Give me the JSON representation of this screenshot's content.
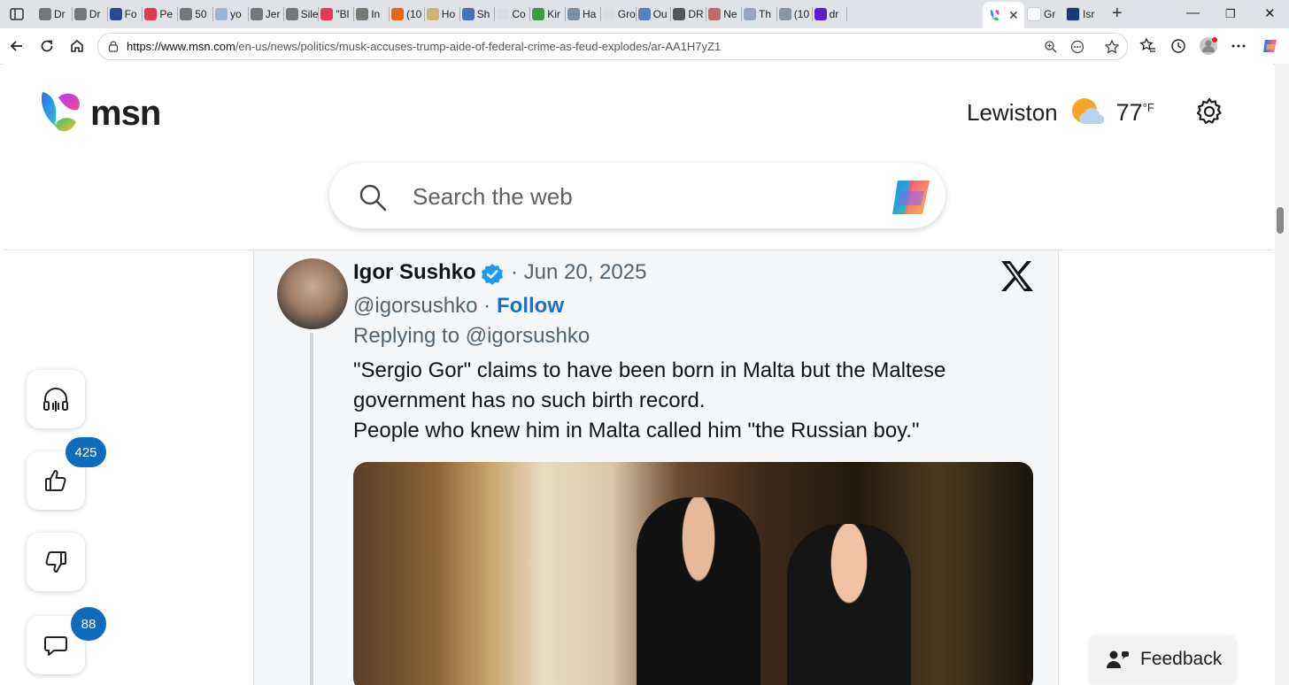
{
  "browser": {
    "tabs": [
      {
        "label": "Dr",
        "icon": "globe-icon",
        "color": "#777777"
      },
      {
        "label": "Dr",
        "icon": "globe-icon",
        "color": "#777777"
      },
      {
        "label": "Fo",
        "icon": "news-icon",
        "color": "#2b4a8b"
      },
      {
        "label": "Pe",
        "icon": "youtube-icon",
        "color": "#e03b54"
      },
      {
        "label": "50",
        "icon": "globe-icon",
        "color": "#777777"
      },
      {
        "label": "yo",
        "icon": "bing-icon",
        "color": "#9fb5d6"
      },
      {
        "label": "Jer",
        "icon": "globe-icon",
        "color": "#777777"
      },
      {
        "label": "Sile",
        "icon": "globe-icon",
        "color": "#777777"
      },
      {
        "label": "\"Bl",
        "icon": "youtube-icon",
        "color": "#e03b54"
      },
      {
        "label": "In ",
        "icon": "globe-icon",
        "color": "#777777"
      },
      {
        "label": "(10",
        "icon": "rss-icon",
        "color": "#e8641b"
      },
      {
        "label": "Ho",
        "icon": "doc-icon",
        "color": "#c9b47a"
      },
      {
        "label": "Sh",
        "icon": "m-icon",
        "color": "#4a6fb5"
      },
      {
        "label": "Co",
        "icon": "blank-icon",
        "color": "#d8dde2"
      },
      {
        "label": "Kir",
        "icon": "sheet-icon",
        "color": "#3f9b4a"
      },
      {
        "label": "Ha",
        "icon": "image-icon",
        "color": "#7a8fa8"
      },
      {
        "label": "Gro",
        "icon": "google-icon",
        "color": "#dddddd"
      },
      {
        "label": "Ou",
        "icon": "m-icon",
        "color": "#5b7fc0"
      },
      {
        "label": "DR",
        "icon": "slash-icon",
        "color": "#555555"
      },
      {
        "label": "Ne",
        "icon": "image-icon",
        "color": "#c26a6a"
      },
      {
        "label": "Th",
        "icon": "gp-icon",
        "color": "#9aa6c4"
      },
      {
        "label": "(10",
        "icon": "image-icon",
        "color": "#8c93a6"
      },
      {
        "label": "dr",
        "icon": "yahoo-icon",
        "color": "#5a1fd1"
      }
    ],
    "active_tab": {
      "icon": "msn-icon"
    },
    "tail_tabs": [
      {
        "label": "Gr",
        "icon": "google-icon",
        "color": "#ffffff"
      },
      {
        "label": "Isr",
        "icon": "news-icon",
        "color": "#1b3a75"
      }
    ],
    "url_host": "https://www.msn.com",
    "url_path": "/en-us/news/politics/musk-accuses-trump-aide-of-federal-crime-as-feud-explodes/ar-AA1H7yZ1"
  },
  "header": {
    "logo_text": "msn",
    "city": "Lewiston",
    "temperature": "77",
    "temp_unit": "°F"
  },
  "search": {
    "placeholder": "Search the web"
  },
  "tweet": {
    "author_name": "Igor Sushko",
    "date": "· Jun 20, 2025",
    "handle": "@igorsushko ·",
    "follow_label": "Follow",
    "replying_to": "Replying to @igorsushko",
    "text_line1": "\"Sergio Gor\" claims to have been born in Malta but the Maltese government has no such birth record.",
    "text_line2": "People who knew him in Malta called him \"the Russian boy.\""
  },
  "engagement": {
    "likes_count": "425",
    "comments_count": "88"
  },
  "feedback": {
    "label": "Feedback"
  }
}
